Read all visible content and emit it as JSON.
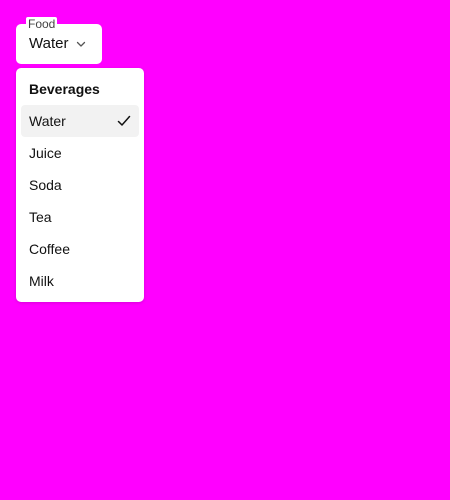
{
  "select": {
    "label": "Food",
    "value": "Water"
  },
  "dropdown": {
    "group_heading": "Beverages",
    "options": [
      {
        "label": "Water",
        "selected": true
      },
      {
        "label": "Juice",
        "selected": false
      },
      {
        "label": "Soda",
        "selected": false
      },
      {
        "label": "Tea",
        "selected": false
      },
      {
        "label": "Coffee",
        "selected": false
      },
      {
        "label": "Milk",
        "selected": false
      }
    ]
  },
  "icons": {
    "trigger": "chevron-down-icon",
    "selected_marker": "checkmark-icon"
  },
  "colors": {
    "background": "#ff00ff",
    "surface": "#ffffff",
    "selected_option": "#f2f2f2"
  }
}
